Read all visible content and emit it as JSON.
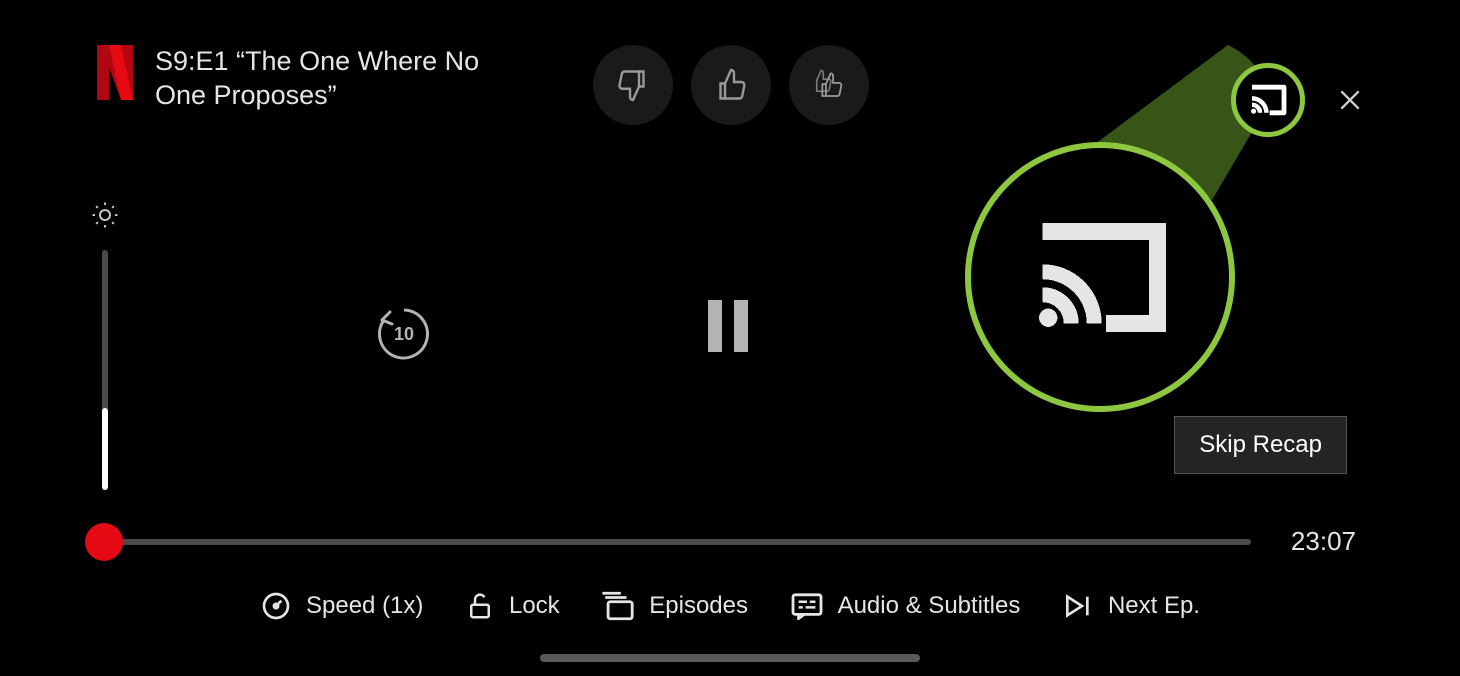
{
  "title": "S9:E1 “The One Where No One Proposes”",
  "rewind_seconds": "10",
  "time_remaining": "23:07",
  "skip_label": "Skip Recap",
  "bottom": {
    "speed": "Speed (1x)",
    "lock": "Lock",
    "episodes": "Episodes",
    "audio": "Audio & Subtitles",
    "next": "Next Ep."
  },
  "colors": {
    "netflix_red": "#e50914",
    "highlight_green": "#8dc63f"
  }
}
